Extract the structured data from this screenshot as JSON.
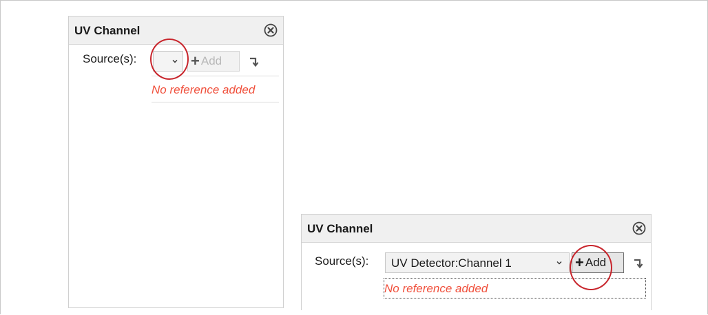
{
  "panel1": {
    "title": "UV Channel",
    "source_label": "Source(s):",
    "dropdown_value": "",
    "add_label": "Add",
    "empty_message": "No reference added"
  },
  "panel2": {
    "title": "UV Channel",
    "source_label": "Source(s):",
    "dropdown_value": "UV Detector:Channel 1",
    "add_label": "Add",
    "empty_message": "No reference added"
  },
  "icons": {
    "close": "close-circle-icon",
    "chevron": "chevron-down-icon",
    "plus": "plus-icon",
    "enter": "enter-arrow-icon"
  },
  "colors": {
    "empty_message": "#f0503c",
    "highlight_circle": "#c8252c",
    "header_bg": "#f0f0f0"
  }
}
